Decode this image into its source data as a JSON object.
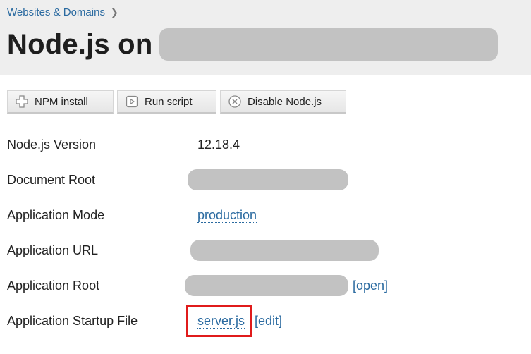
{
  "breadcrumb": {
    "label": "Websites & Domains"
  },
  "header": {
    "title": "Node.js on"
  },
  "toolbar": {
    "npm_install": "NPM install",
    "run_script": "Run script",
    "disable_node": "Disable Node.js"
  },
  "details": {
    "version_label": "Node.js Version",
    "version_value": "12.18.4",
    "docroot_label": "Document Root",
    "mode_label": "Application Mode",
    "mode_value": "production",
    "url_label": "Application URL",
    "approot_label": "Application Root",
    "approot_action": "[open]",
    "startup_label": "Application Startup File",
    "startup_value": "server.js",
    "startup_action": "[edit]"
  },
  "colors": {
    "link": "#2a6aa0",
    "highlight": "#e01b1b",
    "redaction": "#c2c2c2"
  }
}
